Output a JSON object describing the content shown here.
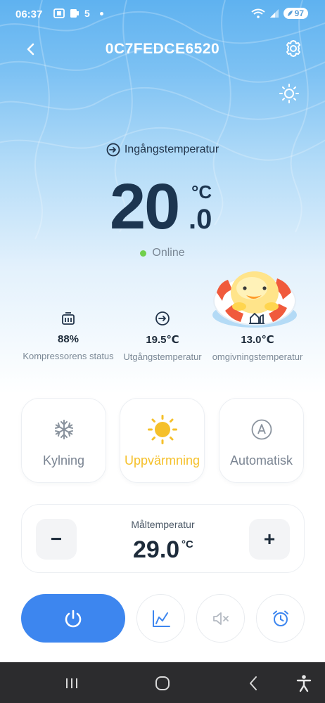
{
  "status_bar": {
    "time": "06:37",
    "notification_count": "5",
    "battery": "97"
  },
  "header": {
    "title": "0C7FEDCE6520",
    "back_icon": "chevron-left-icon",
    "settings_icon": "gear-icon",
    "theme_icon": "sun-icon"
  },
  "temperature": {
    "label": "Ingångstemperatur",
    "integer": "20",
    "unit": "°C",
    "decimal": ".0",
    "status": "Online"
  },
  "stats": [
    {
      "value": "88%",
      "label": "Kompressorens status",
      "icon": "compressor-icon"
    },
    {
      "value": "19.5℃",
      "label": "Utgångstemperatur",
      "icon": "outlet-icon"
    },
    {
      "value": "13.0℃",
      "label": "omgivningstemperatur",
      "icon": "ambient-home-icon"
    }
  ],
  "modes": [
    {
      "label": "Kylning",
      "icon": "snowflake-icon",
      "active": false
    },
    {
      "label": "Uppvärmning",
      "icon": "sun-icon",
      "active": true
    },
    {
      "label": "Automatisk",
      "icon": "auto-a-icon",
      "active": false
    }
  ],
  "target": {
    "label": "Måltemperatur",
    "value": "29.0",
    "unit": "°C",
    "minus": "−",
    "plus": "+"
  },
  "actions": [
    {
      "icon": "power-icon"
    },
    {
      "icon": "chart-icon"
    },
    {
      "icon": "mute-icon"
    },
    {
      "icon": "alarm-clock-icon"
    }
  ],
  "colors": {
    "accent_blue": "#3d86ef",
    "active_yellow": "#f5c02a",
    "online_green": "#72cf4c",
    "nav_bar": "#2c2c2e"
  }
}
